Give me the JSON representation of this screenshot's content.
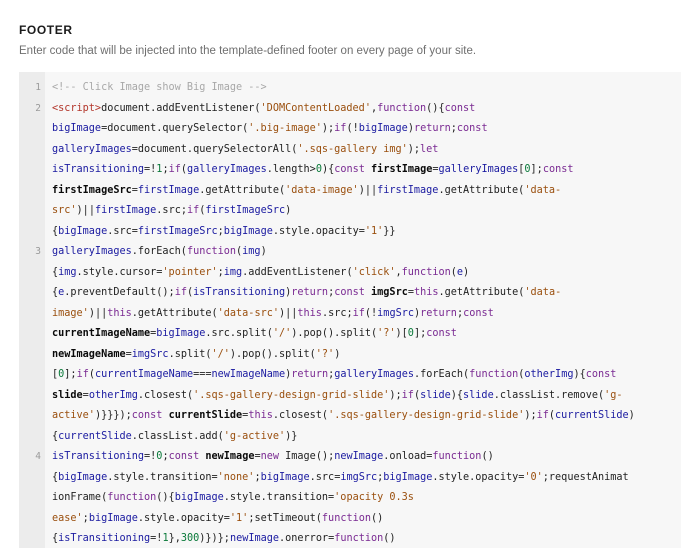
{
  "section": {
    "title": "FOOTER",
    "description": "Enter code that will be injected into the template-defined footer on every page of your site."
  },
  "editor": {
    "rows": [
      {
        "ln": "1",
        "segs": [
          [
            "c",
            "<!-- Click Image show Big Image -->"
          ]
        ]
      },
      {
        "ln": "2",
        "segs": [
          [
            "t",
            "<script>"
          ],
          [
            "p",
            "document.addEventListener("
          ],
          [
            "s",
            "'DOMContentLoaded'"
          ],
          [
            "p",
            ","
          ],
          [
            "k",
            "function"
          ],
          [
            "p",
            "(){"
          ],
          [
            "k",
            "const"
          ]
        ]
      },
      {
        "ln": "",
        "segs": [
          [
            "v",
            "bigImage"
          ],
          [
            "p",
            "=document.querySelector("
          ],
          [
            "s",
            "'.big-image'"
          ],
          [
            "p",
            ");"
          ],
          [
            "k",
            "if"
          ],
          [
            "p",
            "(!"
          ],
          [
            "v",
            "bigImage"
          ],
          [
            "p",
            ")"
          ],
          [
            "k",
            "return"
          ],
          [
            "p",
            ";"
          ],
          [
            "k",
            "const"
          ]
        ]
      },
      {
        "ln": "",
        "segs": [
          [
            "v",
            "galleryImages"
          ],
          [
            "p",
            "=document.querySelectorAll("
          ],
          [
            "s",
            "'.sqs-gallery img'"
          ],
          [
            "p",
            ");"
          ],
          [
            "k",
            "let"
          ]
        ]
      },
      {
        "ln": "",
        "segs": [
          [
            "v",
            "isTransitioning"
          ],
          [
            "p",
            "=!"
          ],
          [
            "n",
            "1"
          ],
          [
            "p",
            ";"
          ],
          [
            "k",
            "if"
          ],
          [
            "p",
            "("
          ],
          [
            "v",
            "galleryImages"
          ],
          [
            "p",
            ".length>"
          ],
          [
            "n",
            "0"
          ],
          [
            "p",
            "){"
          ],
          [
            "k",
            "const"
          ],
          [
            "p",
            " "
          ],
          [
            "b",
            "firstImage"
          ],
          [
            "p",
            "="
          ],
          [
            "v",
            "galleryImages"
          ],
          [
            "p",
            "["
          ],
          [
            "n",
            "0"
          ],
          [
            "p",
            "];"
          ],
          [
            "k",
            "const"
          ]
        ]
      },
      {
        "ln": "",
        "segs": [
          [
            "b",
            "firstImageSrc"
          ],
          [
            "p",
            "="
          ],
          [
            "v",
            "firstImage"
          ],
          [
            "p",
            ".getAttribute("
          ],
          [
            "s",
            "'data-image'"
          ],
          [
            "p",
            ")||"
          ],
          [
            "v",
            "firstImage"
          ],
          [
            "p",
            ".getAttribute("
          ],
          [
            "s",
            "'data-"
          ]
        ]
      },
      {
        "ln": "",
        "segs": [
          [
            "s",
            "src'"
          ],
          [
            "p",
            ")||"
          ],
          [
            "v",
            "firstImage"
          ],
          [
            "p",
            ".src;"
          ],
          [
            "k",
            "if"
          ],
          [
            "p",
            "("
          ],
          [
            "v",
            "firstImageSrc"
          ],
          [
            "p",
            ")"
          ]
        ]
      },
      {
        "ln": "",
        "segs": [
          [
            "p",
            "{"
          ],
          [
            "v",
            "bigImage"
          ],
          [
            "p",
            ".src="
          ],
          [
            "v",
            "firstImageSrc"
          ],
          [
            "p",
            ";"
          ],
          [
            "v",
            "bigImage"
          ],
          [
            "p",
            ".style.opacity="
          ],
          [
            "s",
            "'1'"
          ],
          [
            "p",
            "}}"
          ]
        ]
      },
      {
        "ln": "3",
        "segs": [
          [
            "v",
            "galleryImages"
          ],
          [
            "p",
            ".forEach("
          ],
          [
            "k",
            "function"
          ],
          [
            "p",
            "("
          ],
          [
            "v",
            "img"
          ],
          [
            "p",
            ")"
          ]
        ]
      },
      {
        "ln": "",
        "segs": [
          [
            "p",
            "{"
          ],
          [
            "v",
            "img"
          ],
          [
            "p",
            ".style.cursor="
          ],
          [
            "s",
            "'pointer'"
          ],
          [
            "p",
            ";"
          ],
          [
            "v",
            "img"
          ],
          [
            "p",
            ".addEventListener("
          ],
          [
            "s",
            "'click'"
          ],
          [
            "p",
            ","
          ],
          [
            "k",
            "function"
          ],
          [
            "p",
            "("
          ],
          [
            "v",
            "e"
          ],
          [
            "p",
            ")"
          ]
        ]
      },
      {
        "ln": "",
        "segs": [
          [
            "p",
            "{"
          ],
          [
            "v",
            "e"
          ],
          [
            "p",
            ".preventDefault();"
          ],
          [
            "k",
            "if"
          ],
          [
            "p",
            "("
          ],
          [
            "v",
            "isTransitioning"
          ],
          [
            "p",
            ")"
          ],
          [
            "k",
            "return"
          ],
          [
            "p",
            ";"
          ],
          [
            "k",
            "const"
          ],
          [
            "p",
            " "
          ],
          [
            "b",
            "imgSrc"
          ],
          [
            "p",
            "="
          ],
          [
            "k",
            "this"
          ],
          [
            "p",
            ".getAttribute("
          ],
          [
            "s",
            "'data-"
          ]
        ]
      },
      {
        "ln": "",
        "segs": [
          [
            "s",
            "image'"
          ],
          [
            "p",
            ")||"
          ],
          [
            "k",
            "this"
          ],
          [
            "p",
            ".getAttribute("
          ],
          [
            "s",
            "'data-src'"
          ],
          [
            "p",
            ")||"
          ],
          [
            "k",
            "this"
          ],
          [
            "p",
            ".src;"
          ],
          [
            "k",
            "if"
          ],
          [
            "p",
            "(!"
          ],
          [
            "v",
            "imgSrc"
          ],
          [
            "p",
            ")"
          ],
          [
            "k",
            "return"
          ],
          [
            "p",
            ";"
          ],
          [
            "k",
            "const"
          ]
        ]
      },
      {
        "ln": "",
        "segs": [
          [
            "b",
            "currentImageName"
          ],
          [
            "p",
            "="
          ],
          [
            "v",
            "bigImage"
          ],
          [
            "p",
            ".src.split("
          ],
          [
            "s",
            "'/'"
          ],
          [
            "p",
            ").pop().split("
          ],
          [
            "s",
            "'?'"
          ],
          [
            "p",
            ")["
          ],
          [
            "n",
            "0"
          ],
          [
            "p",
            "];"
          ],
          [
            "k",
            "const"
          ]
        ]
      },
      {
        "ln": "",
        "segs": [
          [
            "b",
            "newImageName"
          ],
          [
            "p",
            "="
          ],
          [
            "v",
            "imgSrc"
          ],
          [
            "p",
            ".split("
          ],
          [
            "s",
            "'/'"
          ],
          [
            "p",
            ").pop().split("
          ],
          [
            "s",
            "'?'"
          ],
          [
            "p",
            ")"
          ]
        ]
      },
      {
        "ln": "",
        "segs": [
          [
            "p",
            "["
          ],
          [
            "n",
            "0"
          ],
          [
            "p",
            "];"
          ],
          [
            "k",
            "if"
          ],
          [
            "p",
            "("
          ],
          [
            "v",
            "currentImageName"
          ],
          [
            "p",
            "==="
          ],
          [
            "v",
            "newImageName"
          ],
          [
            "p",
            ")"
          ],
          [
            "k",
            "return"
          ],
          [
            "p",
            ";"
          ],
          [
            "v",
            "galleryImages"
          ],
          [
            "p",
            ".forEach("
          ],
          [
            "k",
            "function"
          ],
          [
            "p",
            "("
          ],
          [
            "v",
            "otherImg"
          ],
          [
            "p",
            "){"
          ],
          [
            "k",
            "const"
          ]
        ]
      },
      {
        "ln": "",
        "segs": [
          [
            "b",
            "slide"
          ],
          [
            "p",
            "="
          ],
          [
            "v",
            "otherImg"
          ],
          [
            "p",
            ".closest("
          ],
          [
            "s",
            "'.sqs-gallery-design-grid-slide'"
          ],
          [
            "p",
            ");"
          ],
          [
            "k",
            "if"
          ],
          [
            "p",
            "("
          ],
          [
            "v",
            "slide"
          ],
          [
            "p",
            "){"
          ],
          [
            "v",
            "slide"
          ],
          [
            "p",
            ".classList.remove("
          ],
          [
            "s",
            "'g-"
          ]
        ]
      },
      {
        "ln": "",
        "segs": [
          [
            "s",
            "active'"
          ],
          [
            "p",
            ")}}});"
          ],
          [
            "k",
            "const"
          ],
          [
            "p",
            " "
          ],
          [
            "b",
            "currentSlide"
          ],
          [
            "p",
            "="
          ],
          [
            "k",
            "this"
          ],
          [
            "p",
            ".closest("
          ],
          [
            "s",
            "'.sqs-gallery-design-grid-slide'"
          ],
          [
            "p",
            ");"
          ],
          [
            "k",
            "if"
          ],
          [
            "p",
            "("
          ],
          [
            "v",
            "currentSlide"
          ],
          [
            "p",
            ")"
          ]
        ]
      },
      {
        "ln": "",
        "segs": [
          [
            "p",
            "{"
          ],
          [
            "v",
            "currentSlide"
          ],
          [
            "p",
            ".classList.add("
          ],
          [
            "s",
            "'g-active'"
          ],
          [
            "p",
            ")}"
          ]
        ]
      },
      {
        "ln": "4",
        "segs": [
          [
            "v",
            "isTransitioning"
          ],
          [
            "p",
            "=!"
          ],
          [
            "n",
            "0"
          ],
          [
            "p",
            ";"
          ],
          [
            "k",
            "const"
          ],
          [
            "p",
            " "
          ],
          [
            "b",
            "newImage"
          ],
          [
            "p",
            "="
          ],
          [
            "k",
            "new"
          ],
          [
            "p",
            " Image();"
          ],
          [
            "v",
            "newImage"
          ],
          [
            "p",
            ".onload="
          ],
          [
            "k",
            "function"
          ],
          [
            "p",
            "()"
          ]
        ]
      },
      {
        "ln": "",
        "segs": [
          [
            "p",
            "{"
          ],
          [
            "v",
            "bigImage"
          ],
          [
            "p",
            ".style.transition="
          ],
          [
            "s",
            "'none'"
          ],
          [
            "p",
            ";"
          ],
          [
            "v",
            "bigImage"
          ],
          [
            "p",
            ".src="
          ],
          [
            "v",
            "imgSrc"
          ],
          [
            "p",
            ";"
          ],
          [
            "v",
            "bigImage"
          ],
          [
            "p",
            ".style.opacity="
          ],
          [
            "s",
            "'0'"
          ],
          [
            "p",
            ";requestAnimat"
          ]
        ]
      },
      {
        "ln": "",
        "segs": [
          [
            "p",
            "ionFrame("
          ],
          [
            "k",
            "function"
          ],
          [
            "p",
            "(){"
          ],
          [
            "v",
            "bigImage"
          ],
          [
            "p",
            ".style.transition="
          ],
          [
            "s",
            "'opacity 0.3s"
          ]
        ]
      },
      {
        "ln": "",
        "segs": [
          [
            "s",
            "ease'"
          ],
          [
            "p",
            ";"
          ],
          [
            "v",
            "bigImage"
          ],
          [
            "p",
            ".style.opacity="
          ],
          [
            "s",
            "'1'"
          ],
          [
            "p",
            ";setTimeout("
          ],
          [
            "k",
            "function"
          ],
          [
            "p",
            "()"
          ]
        ]
      },
      {
        "ln": "",
        "segs": [
          [
            "p",
            "{"
          ],
          [
            "v",
            "isTransitioning"
          ],
          [
            "p",
            "=!"
          ],
          [
            "n",
            "1"
          ],
          [
            "p",
            "},"
          ],
          [
            "n",
            "300"
          ],
          [
            "p",
            ")})};"
          ],
          [
            "v",
            "newImage"
          ],
          [
            "p",
            ".onerror="
          ],
          [
            "k",
            "function"
          ],
          [
            "p",
            "()"
          ]
        ]
      }
    ]
  }
}
